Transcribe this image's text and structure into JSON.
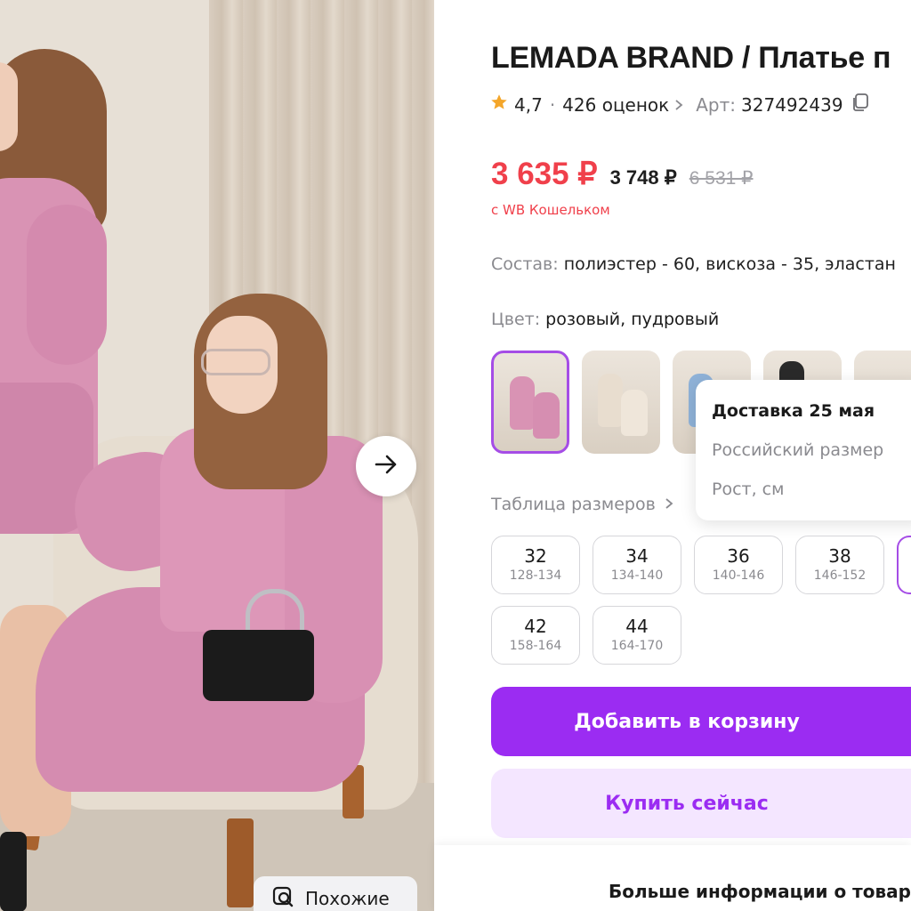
{
  "gallery": {
    "next_icon": "arrow-right-icon",
    "similar_label": "Похожие",
    "similar_icon": "search-image-icon"
  },
  "product": {
    "title": "LEMADA BRAND / Платье п",
    "rating": "4,7",
    "rating_separator": "·",
    "reviews": "426 оценок",
    "article_label": "Арт:",
    "article": "327492439",
    "copy_icon": "copy-icon"
  },
  "price": {
    "current": "3 635 ₽",
    "regular": "3 748 ₽",
    "old": "6 531 ₽",
    "wallet_note": "с WB Кошельком"
  },
  "composition": {
    "label": "Состав:",
    "value": "полиэстер - 60, вискоза - 35, эластан"
  },
  "color": {
    "label": "Цвет:",
    "value": "розовый, пудровый"
  },
  "delivery": {
    "title": "Доставка 25 мая",
    "line1": "Российский размер",
    "line2": "Рост, см"
  },
  "size_table_link": "Таблица размеров",
  "sizes": [
    {
      "num": "32",
      "range": "128-134"
    },
    {
      "num": "34",
      "range": "134-140"
    },
    {
      "num": "36",
      "range": "140-146"
    },
    {
      "num": "38",
      "range": "146-152"
    },
    {
      "num": "42",
      "range": "158-164"
    },
    {
      "num": "44",
      "range": "164-170"
    }
  ],
  "actions": {
    "add_to_cart": "Добавить в корзину",
    "buy_now": "Купить сейчас"
  },
  "footer": {
    "more_info": "Больше информации о товар"
  },
  "colors": {
    "accent": "#9b2cf2",
    "accent_light": "#f4e6ff",
    "price_red": "#f0404b",
    "muted": "#8a8a8f",
    "star": "#f4a62a"
  }
}
